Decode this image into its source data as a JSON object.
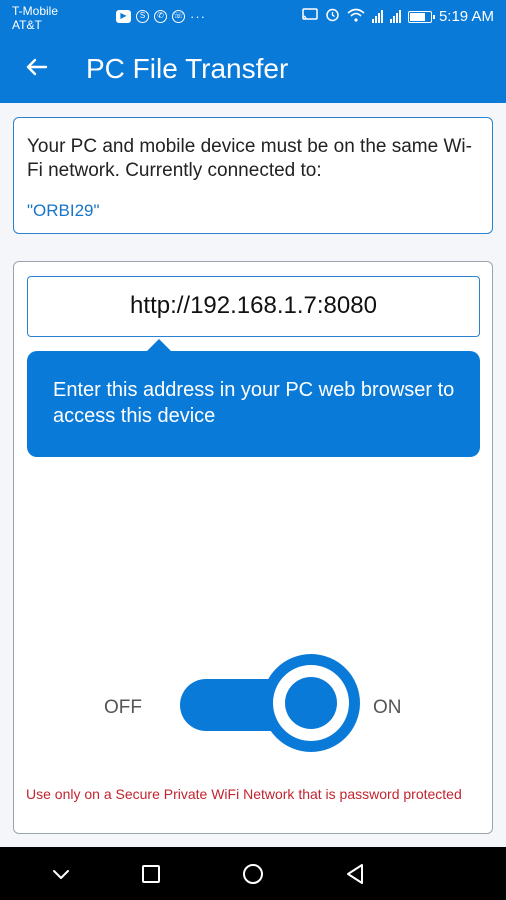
{
  "status_bar": {
    "carrier_line1": "T-Mobile",
    "carrier_line2": "AT&T",
    "notification_dots": "···",
    "time": "5:19 AM",
    "left_icons": [
      "youtube-icon",
      "skype-icon",
      "whatsapp-icon",
      "viber-icon"
    ],
    "right_icons": [
      "cast-icon",
      "alarm-icon",
      "wifi-icon",
      "signal-icon",
      "signal-icon",
      "battery-icon"
    ]
  },
  "app_bar": {
    "title": "PC File Transfer",
    "back_icon": "back-arrow-icon"
  },
  "info": {
    "text": "Your PC and mobile device must be on the same Wi-Fi network. Currently connected to:",
    "network": "\"ORBI29\""
  },
  "server": {
    "address": "http://192.168.1.7:8080",
    "tooltip": "Enter this address in your PC web browser to access this device",
    "off_label": "OFF",
    "on_label": "ON",
    "toggle_state": "on",
    "warning": "Use only on a Secure Private WiFi Network that is password protected"
  },
  "colors": {
    "primary": "#0a7ad9",
    "warning": "#c1252f",
    "link": "#1874c8"
  },
  "nav_bar": {
    "icons": [
      "chevron-down-icon",
      "recents-icon",
      "home-icon",
      "back-icon"
    ]
  }
}
